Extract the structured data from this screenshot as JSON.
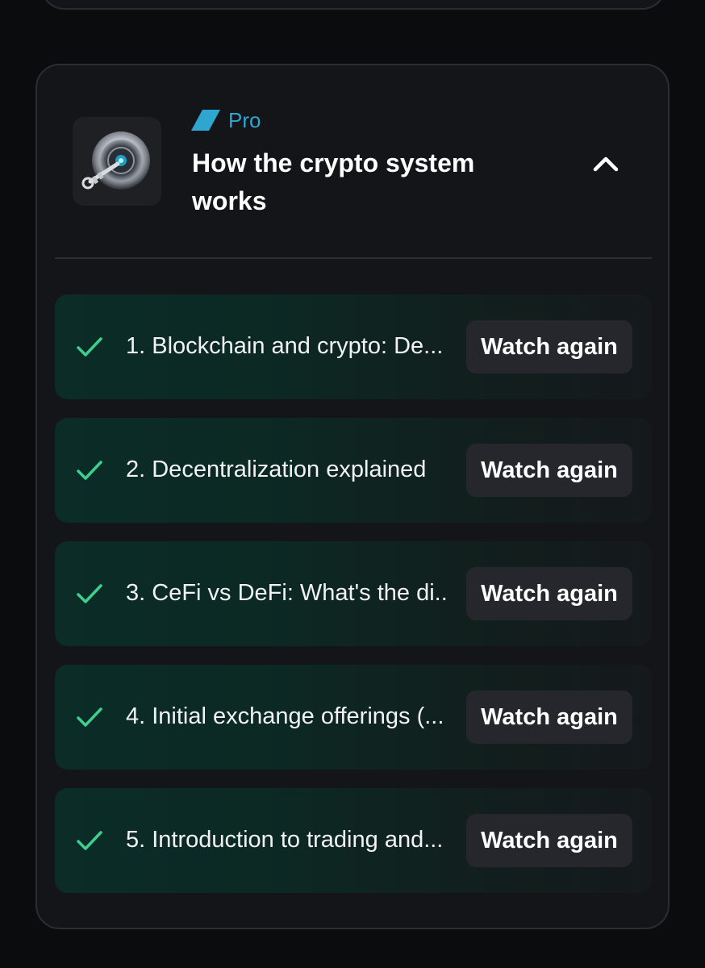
{
  "course": {
    "badge": "Pro",
    "title": "How the crypto system works",
    "thumbnail_icon": "crypto-key-lock-icon",
    "toggle_icon": "chevron-up-icon",
    "accent_color": "#2fa6cf",
    "check_color": "#3ecf8e"
  },
  "lessons": [
    {
      "title": "1. Blockchain and crypto: De...",
      "action": "Watch again",
      "completed": true
    },
    {
      "title": "2. Decentralization explained",
      "action": "Watch again",
      "completed": true
    },
    {
      "title": "3. CeFi vs DeFi: What's the di...",
      "action": "Watch again",
      "completed": true
    },
    {
      "title": "4. Initial exchange offerings (...",
      "action": "Watch again",
      "completed": true
    },
    {
      "title": "5. Introduction to trading and...",
      "action": "Watch again",
      "completed": true
    }
  ]
}
